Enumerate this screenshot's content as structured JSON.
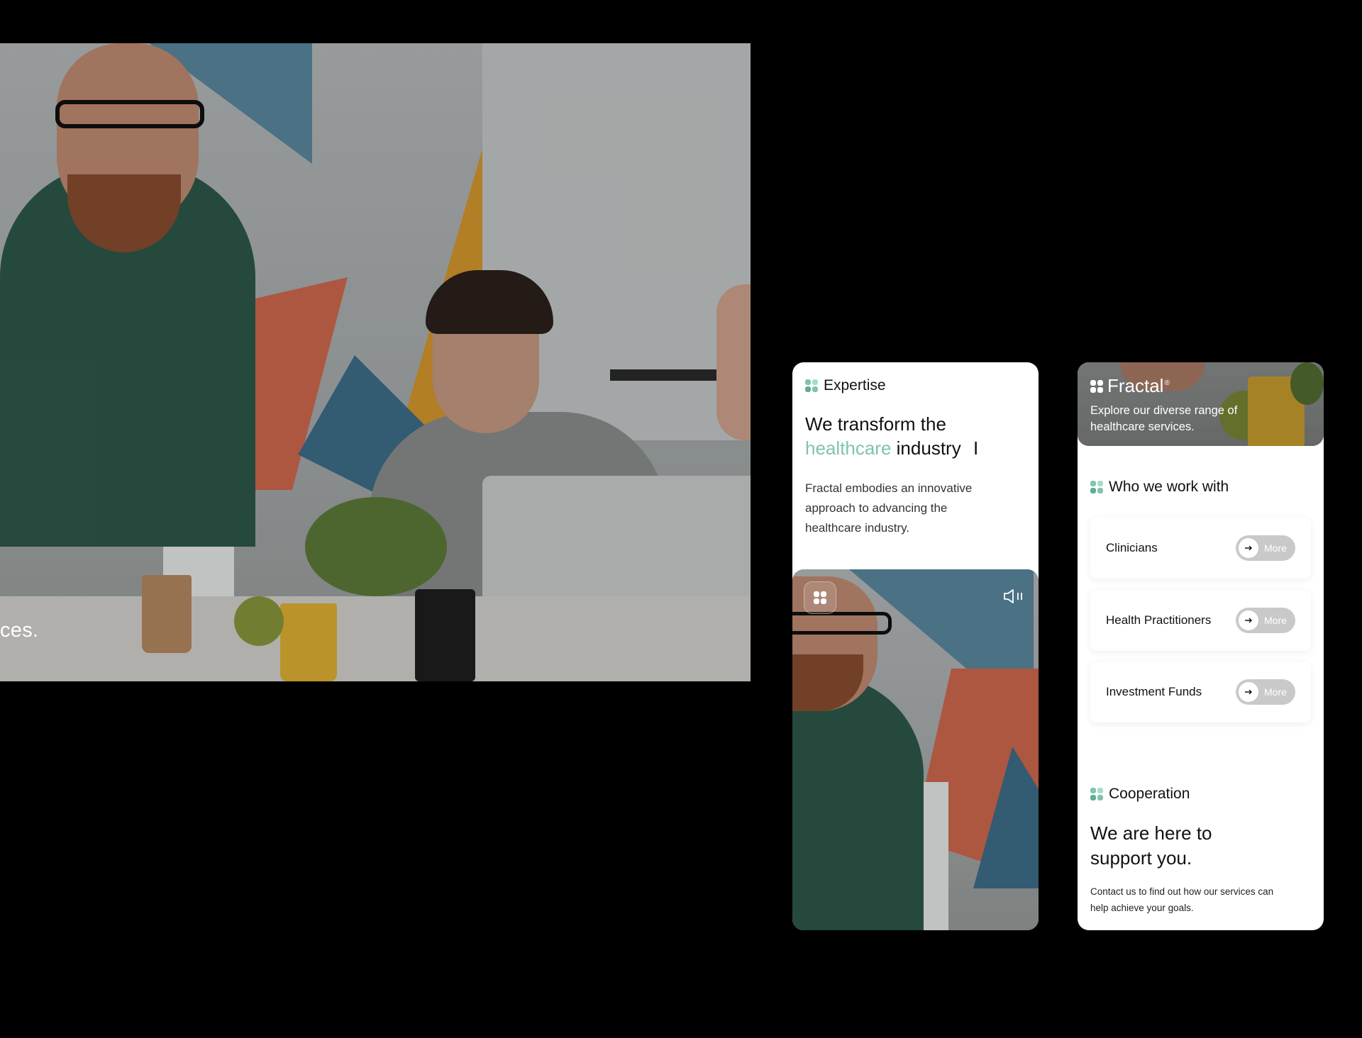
{
  "desktop": {
    "caption": "ces."
  },
  "phone1": {
    "section_label": "Expertise",
    "headline_part1": "We transform the",
    "headline_accent": "healthcare",
    "headline_part2": "industry",
    "cursor": "I",
    "description": "Fractal embodies an innovative approach to advancing the healthcare industry.",
    "media_badge_icon": "fractal-logo-icon",
    "sound_icon": "speaker-icon"
  },
  "phone2": {
    "brand": "Fractal",
    "brand_mark": "®",
    "tagline": "Explore our diverse range of healthcare services.",
    "work_label": "Who we work with",
    "work_items": [
      {
        "name": "Clinicians",
        "button": "More"
      },
      {
        "name": "Health Practitioners",
        "button": "More"
      },
      {
        "name": "Investment Funds",
        "button": "More"
      }
    ],
    "coop_label": "Cooperation",
    "coop_headline": "We are here to support you.",
    "coop_text": "Contact us to find out how our services can help achieve your goals."
  },
  "colors": {
    "background": "#000000",
    "accent": "#7fc4ad",
    "card": "#ffffff",
    "button_pill": "#c9c9c9"
  }
}
